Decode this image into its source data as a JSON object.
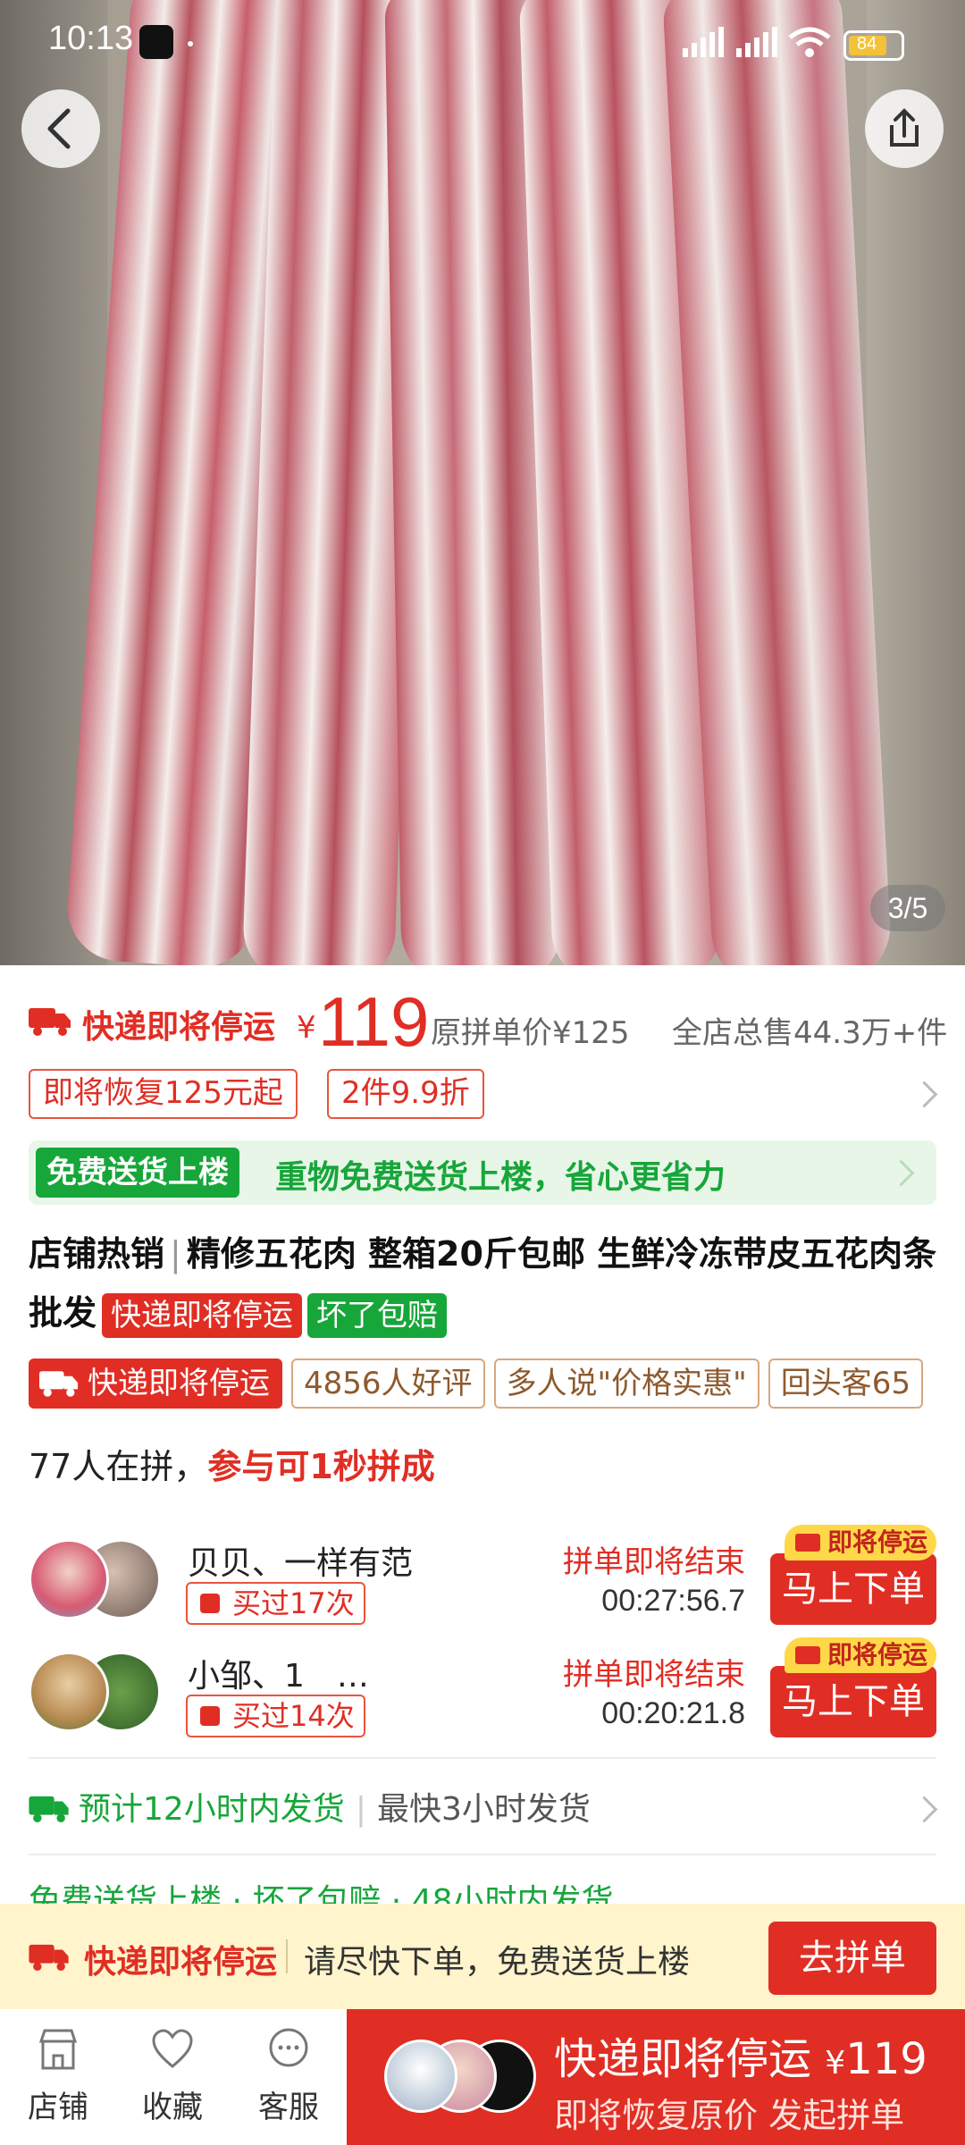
{
  "status_bar": {
    "time": "10:13",
    "battery": "84"
  },
  "gallery": {
    "counter": "3/5"
  },
  "price": {
    "label": "快递即将停运",
    "currency": "¥",
    "amount": "119",
    "original": "原拼单价¥125",
    "total_sold": "全店总售44.3万+件"
  },
  "promo_tags": [
    "即将恢复125元起",
    "2件9.9折"
  ],
  "free_delivery": {
    "chip": "免费送货上楼",
    "text": "重物免费送货上楼，省心更省力"
  },
  "title": {
    "hot": "店铺热销",
    "sep": "|",
    "text": "精修五花肉 整箱20斤包邮 生鲜冷冻带皮五花肉条 批发",
    "chip_red": "快递即将停运",
    "chip_green": "坏了包赔"
  },
  "tags": {
    "solid": "快递即将停运",
    "outline": [
      "4856人好评",
      "多人说\"价格实惠\"",
      "回头客65"
    ]
  },
  "group": {
    "count": "77人在拼，",
    "join": "参与可1秒拼成"
  },
  "groups": [
    {
      "names": "贝贝、一样有范",
      "bought": "买过17次",
      "ending": "拼单即将结束",
      "timer": "00:27:56.7",
      "badge": "即将停运",
      "button": "马上下单"
    },
    {
      "names": "小邹、1　…",
      "bought": "买过14次",
      "ending": "拼单即将结束",
      "timer": "00:20:21.8",
      "badge": "即将停运",
      "button": "马上下单"
    }
  ],
  "shipping": {
    "estimate": "预计12小时内发货",
    "sep": "|",
    "fastest": "最快3小时发货"
  },
  "shipping2": "免费送货上楼 · 坏了包赔 · 48小时内发货",
  "notice": {
    "label": "快递即将停运",
    "message": "请尽快下单，免费送货上楼",
    "button": "去拼单"
  },
  "bottom_nav": {
    "store": "店铺",
    "favorite": "收藏",
    "service": "客服"
  },
  "cta": {
    "line1": "快递即将停运",
    "currency": "¥",
    "price": "119",
    "line2": "即将恢复原价 发起拼单"
  },
  "colors": {
    "accent": "#e02e24",
    "green": "#17a63a",
    "notice_bg": "#fff4cc"
  }
}
